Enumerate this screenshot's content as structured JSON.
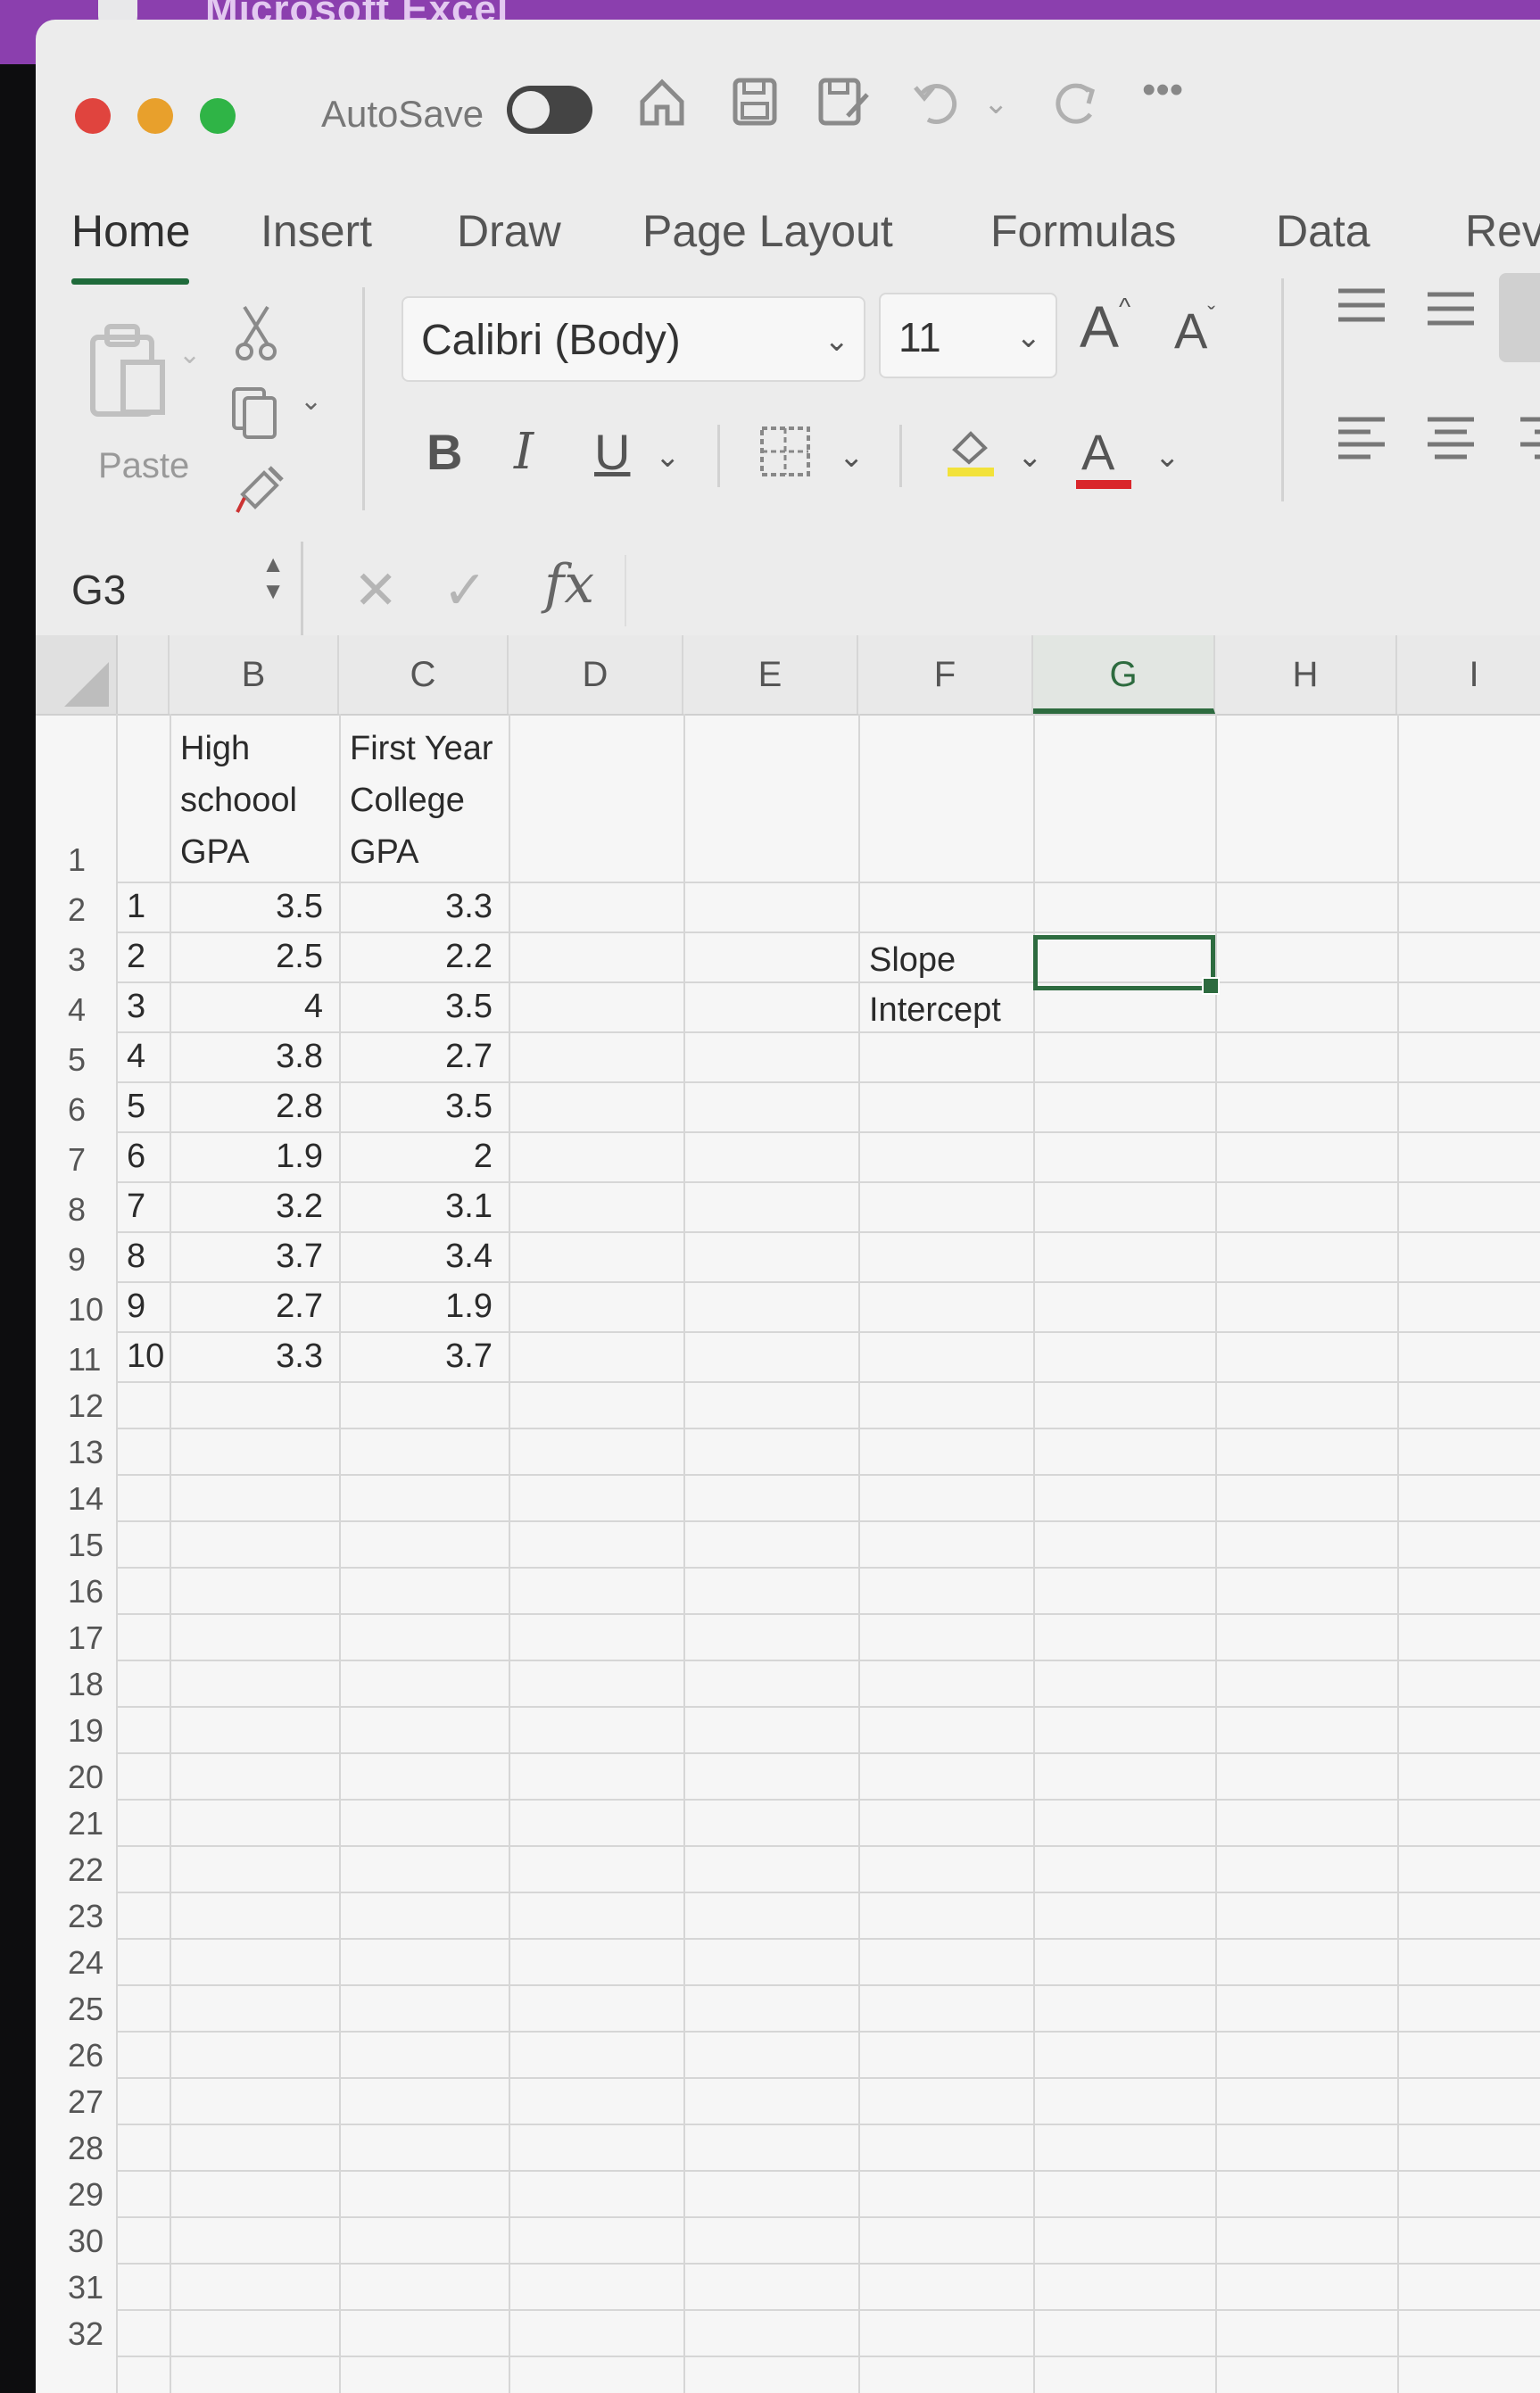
{
  "app": {
    "title": "Microsoft Excel"
  },
  "toolbar": {
    "autosave_label": "AutoSave",
    "more_label": "•••"
  },
  "ribbon": {
    "tabs": [
      "Home",
      "Insert",
      "Draw",
      "Page Layout",
      "Formulas",
      "Data",
      "Rev"
    ],
    "active_tab": "Home",
    "paste_label": "Paste",
    "font_name": "Calibri (Body)",
    "font_size": "11",
    "bold": "B",
    "italic": "I",
    "underline": "U",
    "font_color_glyph": "A",
    "grow_font": "A",
    "shrink_font": "A"
  },
  "formula_bar": {
    "name_box": "G3",
    "fx": "fx",
    "value": ""
  },
  "columns": [
    "B",
    "C",
    "D",
    "E",
    "F",
    "G",
    "H",
    "I"
  ],
  "selected_column": "G",
  "header_row": {
    "b": [
      "High",
      "schoool",
      "GPA"
    ],
    "c": [
      "First Year",
      "College",
      "GPA"
    ]
  },
  "rows": [
    "1",
    "2",
    "3",
    "4",
    "5",
    "6",
    "7",
    "8",
    "9",
    "10",
    "11",
    "12",
    "13",
    "14",
    "15",
    "16",
    "17",
    "18",
    "19",
    "20",
    "21",
    "22",
    "23",
    "24",
    "25",
    "26",
    "27",
    "28",
    "29",
    "30",
    "31",
    "32"
  ],
  "data": [
    {
      "a": "1",
      "b": "3.5",
      "c": "3.3"
    },
    {
      "a": "2",
      "b": "2.5",
      "c": "2.2"
    },
    {
      "a": "3",
      "b": "4",
      "c": "3.5"
    },
    {
      "a": "4",
      "b": "3.8",
      "c": "2.7"
    },
    {
      "a": "5",
      "b": "2.8",
      "c": "3.5"
    },
    {
      "a": "6",
      "b": "1.9",
      "c": "2"
    },
    {
      "a": "7",
      "b": "3.2",
      "c": "3.1"
    },
    {
      "a": "8",
      "b": "3.7",
      "c": "3.4"
    },
    {
      "a": "9",
      "b": "2.7",
      "c": "1.9"
    },
    {
      "a": "10",
      "b": "3.3",
      "c": "3.7"
    }
  ],
  "labels": {
    "f3": "Slope",
    "f4": "Intercept"
  },
  "colors": {
    "accent": "#2d6b3f",
    "titlebar": "#8b3fae"
  }
}
